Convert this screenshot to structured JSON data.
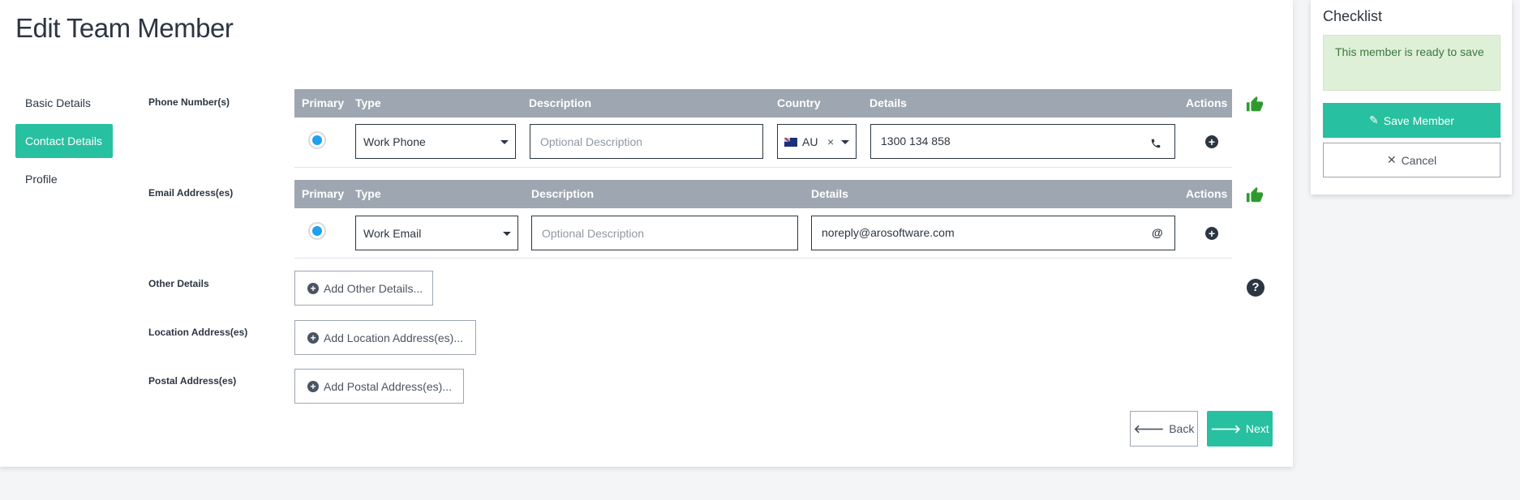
{
  "page": {
    "title": "Edit Team Member"
  },
  "side_nav": {
    "items": [
      {
        "label": "Basic Details",
        "active": false
      },
      {
        "label": "Contact Details",
        "active": true
      },
      {
        "label": "Profile",
        "active": false
      }
    ]
  },
  "phone": {
    "section_label": "Phone Number(s)",
    "headers": {
      "primary": "Primary",
      "type": "Type",
      "description": "Description",
      "country": "Country",
      "details": "Details",
      "actions": "Actions"
    },
    "row": {
      "type": "Work Phone",
      "description_placeholder": "Optional Description",
      "country": "AU",
      "country_clear": "×",
      "details": "1300 134 858"
    }
  },
  "email": {
    "section_label": "Email Address(es)",
    "headers": {
      "primary": "Primary",
      "type": "Type",
      "description": "Description",
      "details": "Details",
      "actions": "Actions"
    },
    "row": {
      "type": "Work Email",
      "description_placeholder": "Optional Description",
      "details": "noreply@arosoftware.com",
      "icon": "@"
    }
  },
  "other": {
    "section_label": "Other Details",
    "button": "Add Other Details..."
  },
  "location": {
    "section_label": "Location Address(es)",
    "button": "Add Location Address(es)..."
  },
  "postal": {
    "section_label": "Postal Address(es)",
    "button": "Add Postal Address(es)..."
  },
  "nav_buttons": {
    "back": "Back",
    "next": "Next"
  },
  "checklist": {
    "title": "Checklist",
    "status": "This member is ready to save",
    "save": "Save Member",
    "cancel": "Cancel"
  },
  "colors": {
    "accent": "#27c0a0",
    "header_bg": "#9ea6b1",
    "ok_bg": "#dff0d8",
    "thumb": "#2e9a2e"
  }
}
